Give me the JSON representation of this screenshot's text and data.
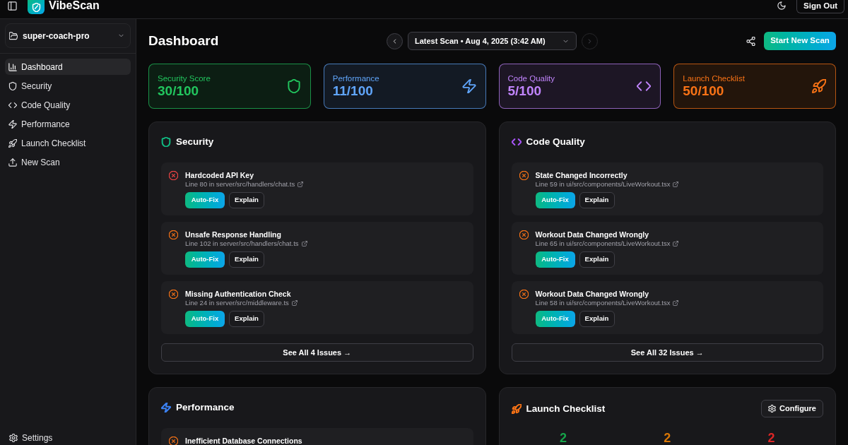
{
  "top_bar": {
    "app_name": "VibeScan",
    "sign_out": "Sign Out"
  },
  "sidebar": {
    "project": "super-coach-pro",
    "nav": [
      {
        "label": "Dashboard",
        "selected": true
      },
      {
        "label": "Security",
        "selected": false
      },
      {
        "label": "Code Quality",
        "selected": false
      },
      {
        "label": "Performance",
        "selected": false
      },
      {
        "label": "Launch Checklist",
        "selected": false
      },
      {
        "label": "New Scan",
        "selected": false
      }
    ],
    "footer": "Settings"
  },
  "header": {
    "title": "Dashboard",
    "previous": {
      "disabled": false
    },
    "scan_selector": {
      "value": "Latest Scan • Aug 4, 2025 (3:42 AM)"
    },
    "next": {
      "disabled": true
    },
    "primary_button": "Start New Scan"
  },
  "score_cards": [
    {
      "label": "Security Score",
      "value": "30/100",
      "color": "#22c55e"
    },
    {
      "label": "Performance",
      "value": "11/100",
      "color": "#60a5fa"
    },
    {
      "label": "Code Quality",
      "value": "5/100",
      "color": "#c084fc"
    },
    {
      "label": "Launch Checklist",
      "value": "50/100",
      "color": "#f97316"
    }
  ],
  "sections": [
    {
      "kind": "issues",
      "title": "Security",
      "color": "#10b981",
      "issues": [
        {
          "title": "Hardcoded API Key",
          "location": "Line 80 in server/src/handlers/chat.ts",
          "color": "#ef4444",
          "actions": [
            {
              "label": "Auto-Fix",
              "kind": "primary"
            },
            {
              "label": "Explain",
              "kind": "secondary"
            }
          ]
        },
        {
          "title": "Unsafe Response Handling",
          "location": "Line 102 in server/src/handlers/chat.ts",
          "color": "#f97316",
          "actions": [
            {
              "label": "Auto-Fix",
              "kind": "primary"
            },
            {
              "label": "Explain",
              "kind": "secondary"
            }
          ]
        },
        {
          "title": "Missing Authentication Check",
          "location": "Line 24 in server/src/middleware.ts",
          "color": "#f97316",
          "actions": [
            {
              "label": "Auto-Fix",
              "kind": "primary"
            },
            {
              "label": "Explain",
              "kind": "secondary"
            }
          ]
        }
      ],
      "see_all": "See All 4 Issues →"
    },
    {
      "kind": "issues",
      "title": "Code Quality",
      "color": "#a855f7",
      "issues": [
        {
          "title": "State Changed Incorrectly",
          "location": "Line 59 in ui/src/components/LiveWorkout.tsx",
          "color": "#f97316",
          "actions": [
            {
              "label": "Auto-Fix",
              "kind": "primary"
            },
            {
              "label": "Explain",
              "kind": "secondary"
            }
          ]
        },
        {
          "title": "Workout Data Changed Wrongly",
          "location": "Line 65 in ui/src/components/LiveWorkout.tsx",
          "color": "#f97316",
          "actions": [
            {
              "label": "Auto-Fix",
              "kind": "primary"
            },
            {
              "label": "Explain",
              "kind": "secondary"
            }
          ]
        },
        {
          "title": "Workout Data Changed Wrongly",
          "location": "Line 58 in ui/src/components/LiveWorkout.tsx",
          "color": "#f97316",
          "actions": [
            {
              "label": "Auto-Fix",
              "kind": "primary"
            },
            {
              "label": "Explain",
              "kind": "secondary"
            }
          ]
        }
      ],
      "see_all": "See All 32 Issues →"
    },
    {
      "kind": "issues",
      "title": "Performance",
      "color": "#3b82f6",
      "issues": [
        {
          "title": "Inefficient Database Connections",
          "color": "#f97316"
        }
      ]
    },
    {
      "kind": "checklist",
      "title": "Launch Checklist",
      "color": "#f97316",
      "button": "Configure",
      "stats": [
        {
          "value": "2",
          "color": "#16a34a"
        },
        {
          "value": "2",
          "color": "#d97706"
        },
        {
          "value": "2",
          "color": "#dc2626"
        }
      ]
    }
  ]
}
